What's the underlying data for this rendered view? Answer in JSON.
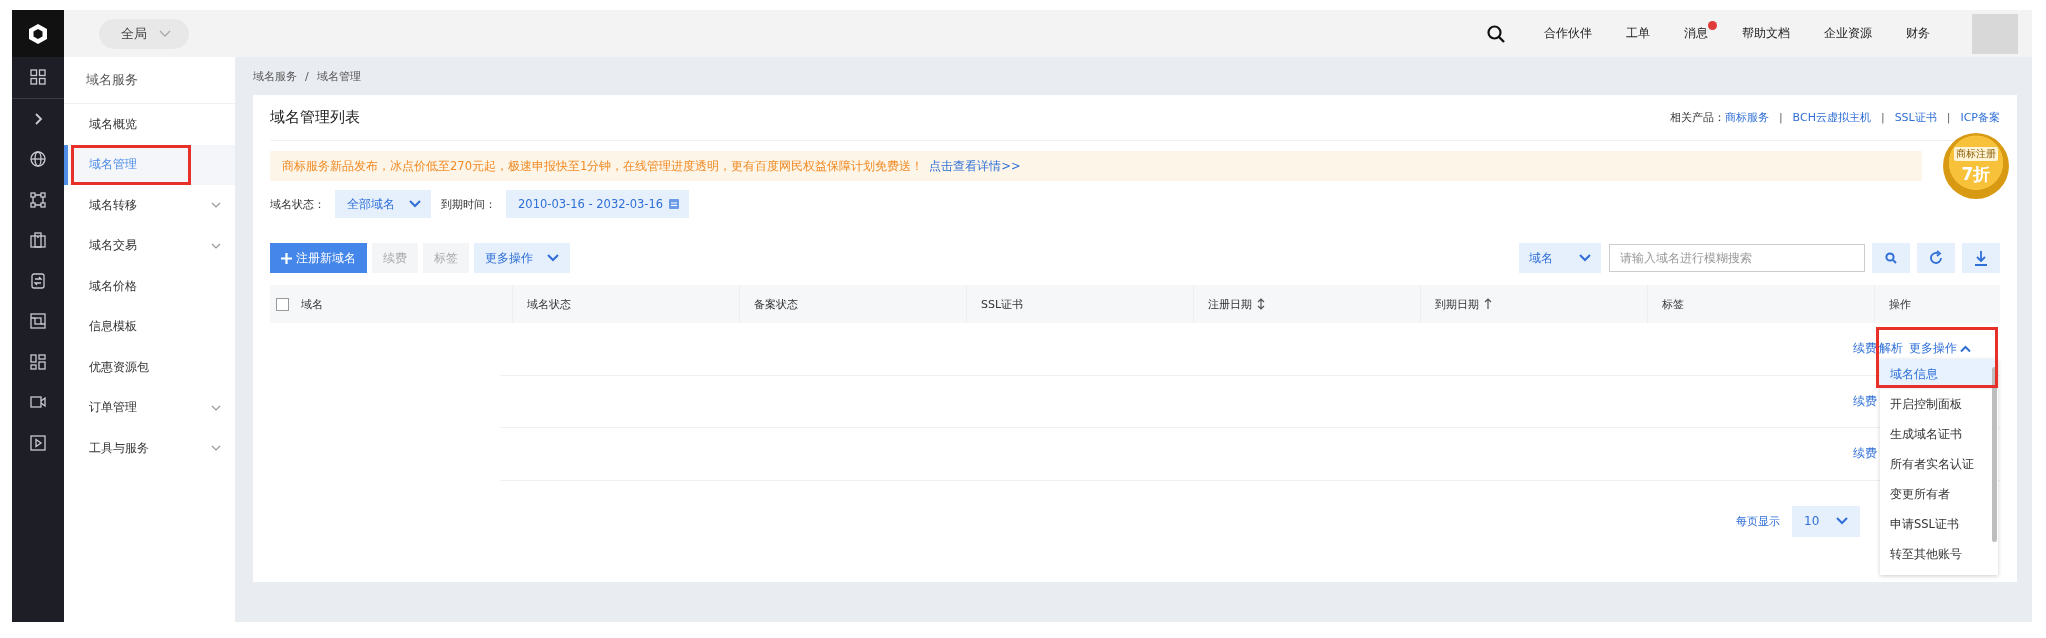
{
  "topbar": {
    "scope": "全局",
    "nav": [
      {
        "label": "合作伙伴",
        "dot": false
      },
      {
        "label": "工单",
        "dot": false
      },
      {
        "label": "消息",
        "dot": true
      },
      {
        "label": "帮助文档",
        "dot": false
      },
      {
        "label": "企业资源",
        "dot": false
      },
      {
        "label": "财务",
        "dot": false
      }
    ]
  },
  "sidebar": {
    "title": "域名服务",
    "items": [
      {
        "label": "域名概览",
        "selected": false,
        "submenu": false,
        "annotated": false
      },
      {
        "label": "域名管理",
        "selected": true,
        "submenu": false,
        "annotated": true
      },
      {
        "label": "域名转移",
        "selected": false,
        "submenu": true,
        "annotated": false
      },
      {
        "label": "域名交易",
        "selected": false,
        "submenu": true,
        "annotated": false
      },
      {
        "label": "域名价格",
        "selected": false,
        "submenu": false,
        "annotated": false
      },
      {
        "label": "信息模板",
        "selected": false,
        "submenu": false,
        "annotated": false
      },
      {
        "label": "优惠资源包",
        "selected": false,
        "submenu": false,
        "annotated": false
      },
      {
        "label": "订单管理",
        "selected": false,
        "submenu": true,
        "annotated": false
      },
      {
        "label": "工具与服务",
        "selected": false,
        "submenu": true,
        "annotated": false
      }
    ]
  },
  "breadcrumb": {
    "items": [
      "域名服务",
      "域名管理"
    ],
    "separator": "/"
  },
  "card": {
    "title": "域名管理列表",
    "related_label": "相关产品：",
    "related_links": [
      "商标服务",
      "BCH云虚拟主机",
      "SSL证书",
      "ICP备案"
    ],
    "separator": "|"
  },
  "notice": {
    "text": "商标服务新品发布，冰点价低至270元起，极速申报快至1分钟，在线管理进度透明，更有百度网民权益保障计划免费送！",
    "link": "点击查看详情>>"
  },
  "promo_badge": {
    "ribbon": "商标注册",
    "discount": "7折"
  },
  "filters": {
    "status_label": "域名状态：",
    "status_value": "全部域名",
    "expiry_label": "到期时间：",
    "expiry_value": "2010-03-16 - 2032-03-16"
  },
  "toolbar": {
    "buttons": [
      {
        "label": "注册新域名",
        "kind": "primary",
        "disabled": false
      },
      {
        "label": "续费",
        "kind": "plain",
        "disabled": true
      },
      {
        "label": "标签",
        "kind": "plain",
        "disabled": true
      },
      {
        "label": "更多操作",
        "kind": "dropdown",
        "disabled": false
      }
    ],
    "search_field": "域名",
    "search_placeholder": "请输入域名进行模糊搜索"
  },
  "table": {
    "all_checked": false,
    "columns": [
      {
        "label": "域名"
      },
      {
        "label": "域名状态"
      },
      {
        "label": "备案状态"
      },
      {
        "label": "SSL证书"
      },
      {
        "label": "注册日期",
        "sortable": true,
        "sorted": false
      },
      {
        "label": "到期日期",
        "sortable": true,
        "sorted": true
      },
      {
        "label": "标签"
      },
      {
        "label": "操作"
      }
    ],
    "rows": [
      {
        "actions": [
          "续费",
          "解析"
        ],
        "more": "更多操作",
        "menu_open": true,
        "annotated": true
      },
      {
        "actions": [
          "续费"
        ]
      },
      {
        "actions": [
          "续费"
        ]
      }
    ]
  },
  "more_menu": {
    "items": [
      {
        "label": "域名信息",
        "selected": true
      },
      {
        "label": "开启控制面板",
        "selected": false
      },
      {
        "label": "生成域名证书",
        "selected": false
      },
      {
        "label": "所有者实名认证",
        "selected": false
      },
      {
        "label": "变更所有者",
        "selected": false
      },
      {
        "label": "申请SSL证书",
        "selected": false
      },
      {
        "label": "转至其他账号",
        "selected": false
      }
    ]
  },
  "pagination": {
    "label": "每页显示",
    "page_size": "10"
  }
}
